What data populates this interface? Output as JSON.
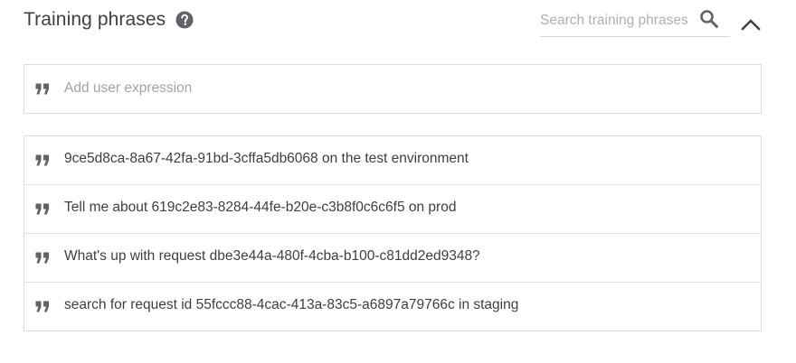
{
  "header": {
    "title": "Training phrases",
    "help_icon": "help-circle-icon",
    "search": {
      "placeholder": "Search training phrases",
      "value": ""
    },
    "search_icon": "search-icon",
    "collapse_icon": "chevron-up-icon"
  },
  "add_expression": {
    "placeholder": "Add user expression",
    "value": "",
    "icon": "quote-icon"
  },
  "phrases": [
    {
      "text": "9ce5d8ca-8a67-42fa-91bd-3cffa5db6068  on the test environment"
    },
    {
      "text": "Tell me about 619c2e83-8284-44fe-b20e-c3b8f0c6c6f5  on prod"
    },
    {
      "text": "What's up with request dbe3e44a-480f-4cba-b100-c81dd2ed9348?"
    },
    {
      "text": "search for request id 55fccc88-4cac-413a-83c5-a6897a79766c in staging"
    }
  ],
  "colors": {
    "text": "#3c4043",
    "icon": "#5f6368",
    "border": "#dcdcdc",
    "placeholder": "#a3a3a3"
  }
}
